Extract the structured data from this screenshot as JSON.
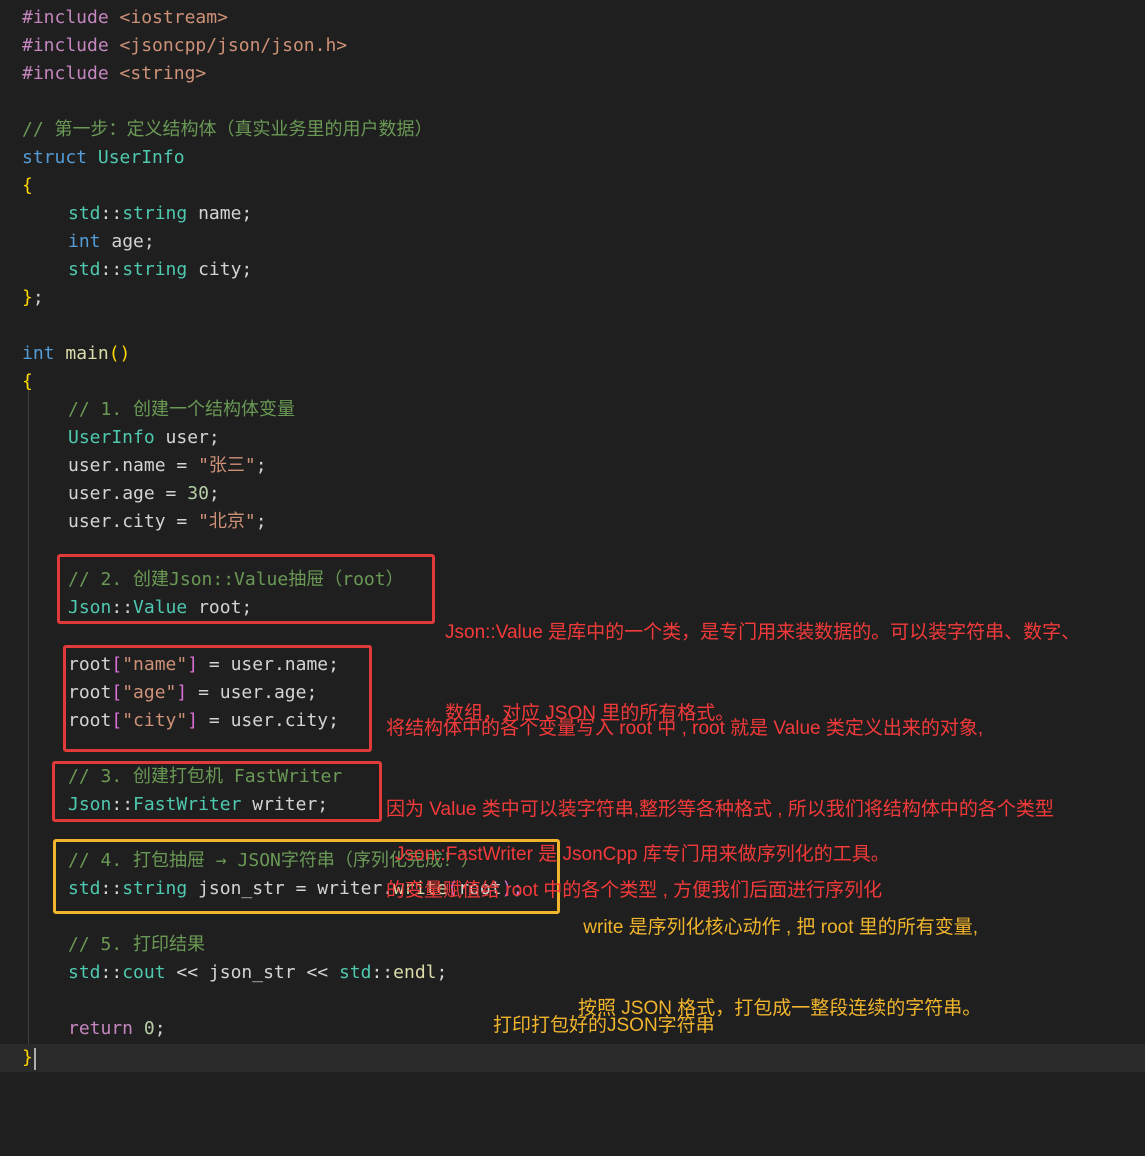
{
  "code": {
    "l1": [
      "#include",
      " ",
      "<iostream>"
    ],
    "l2": [
      "#include",
      " ",
      "<jsoncpp/json/json.h>"
    ],
    "l3": [
      "#include",
      " ",
      "<string>"
    ],
    "l5": "// 第一步：定义结构体（真实业务里的用户数据）",
    "l6": [
      "struct",
      " ",
      "UserInfo"
    ],
    "l7": "{",
    "l8": [
      "std",
      "::",
      "string",
      " name;"
    ],
    "l9": [
      "int",
      " age;"
    ],
    "l10": [
      "std",
      "::",
      "string",
      " city;"
    ],
    "l11": [
      "}",
      ";"
    ],
    "l13": [
      "int",
      " ",
      "main",
      "()"
    ],
    "l14": "{",
    "l15": "// 1. 创建一个结构体变量",
    "l16": [
      "UserInfo",
      " user;"
    ],
    "l17": [
      "user",
      ".",
      "name",
      " = ",
      "\"张三\"",
      ";"
    ],
    "l18": [
      "user",
      ".",
      "age",
      " = ",
      "30",
      ";"
    ],
    "l19": [
      "user",
      ".",
      "city",
      " = ",
      "\"北京\"",
      ";"
    ],
    "l21": "// 2. 创建Json::Value抽屉（root）",
    "l22": [
      "Json",
      "::",
      "Value",
      " root;"
    ],
    "l24": [
      "root",
      "[",
      "\"name\"",
      "]",
      " = ",
      "user",
      ".",
      "name",
      ";"
    ],
    "l25": [
      "root",
      "[",
      "\"age\"",
      "]",
      " = ",
      "user",
      ".",
      "age",
      ";"
    ],
    "l26": [
      "root",
      "[",
      "\"city\"",
      "]",
      " = ",
      "user",
      ".",
      "city",
      ";"
    ],
    "l27": "// 3. 创建打包机 FastWriter",
    "l28": [
      "Json",
      "::",
      "FastWriter",
      " writer;"
    ],
    "l30": "// 4. 打包抽屉 → JSON字符串（序列化完成！）",
    "l31": [
      "std",
      "::",
      "string",
      " json_str = ",
      "writer",
      ".",
      "write",
      "(",
      "root",
      ");"
    ],
    "l33": "// 5. 打印结果",
    "l34": [
      "std",
      "::",
      "cout",
      " << json_str << ",
      "std",
      "::",
      "endl",
      ";"
    ],
    "l36": [
      "return",
      " ",
      "0",
      ";"
    ],
    "l37": "}"
  },
  "annotations": {
    "value_1": "Json::Value 是库中的一个类，是专门用来装数据的。可以装字符串、数字、",
    "value_2": "数组，对应 JSON 里的所有格式。",
    "assign_1": "将结构体中的各个变量写入 root 中 , root 就是 Value 类定义出来的对象,",
    "assign_2": "因为 Value 类中可以装字符串,整形等各种格式 , 所以我们将结构体中的各个类型",
    "assign_3": "的变量赋值给 root 中的各个类型 , 方便我们后面进行序列化",
    "writer_1": "Json::FastWriter 是 JsonCpp 库专门用来做序列化的工具。",
    "write_1": " write 是序列化核心动作 , 把 root 里的所有变量,",
    "write_2": "按照 JSON 格式，打包成一整段连续的字符串。",
    "print_1": "打印打包好的JSON字符串"
  },
  "colors": {
    "red_box": "#e03a3a",
    "yellow_box": "#f0b42d",
    "background": "#1f1f1f"
  }
}
